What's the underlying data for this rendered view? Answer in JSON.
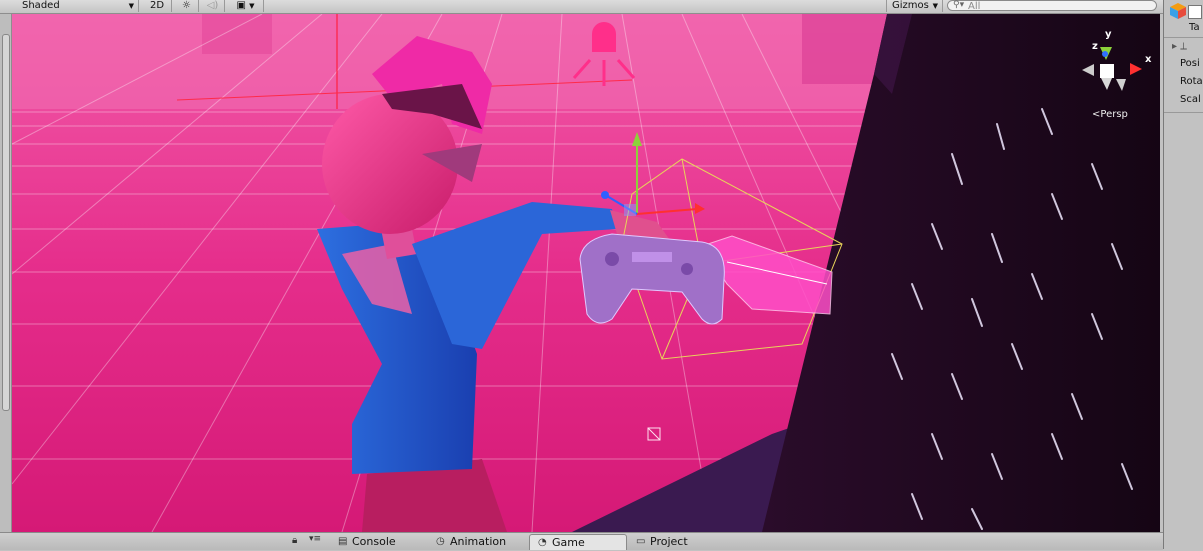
{
  "toolbar": {
    "shading_mode": "Shaded",
    "mode_2d": "2D",
    "lighting_icon": "sun-icon",
    "audio_icon": "speaker-icon",
    "effects_icon": "image-icon",
    "gizmos_label": "Gizmos",
    "search_placeholder": "All"
  },
  "viewport": {
    "perspective_label": "Persp",
    "axis_labels": {
      "x": "x",
      "y": "y",
      "z": "z"
    }
  },
  "inspector": {
    "tag_label": "Ta",
    "position_label": "Posi",
    "rotation_label": "Rota",
    "scale_label": "Scal"
  },
  "tabs": [
    {
      "label": "Console",
      "icon": "console-icon",
      "active": false
    },
    {
      "label": "Animation",
      "icon": "animation-clock-icon",
      "active": false
    },
    {
      "label": "Game",
      "icon": "game-pacman-icon",
      "active": true
    },
    {
      "label": "Project",
      "icon": "folder-icon",
      "active": false
    }
  ],
  "colors": {
    "floor_pink": "#e0207a",
    "wall_dark": "#1d0820",
    "floor_purple": "#3a1a50",
    "selection_yellow": "#e8d45a"
  }
}
